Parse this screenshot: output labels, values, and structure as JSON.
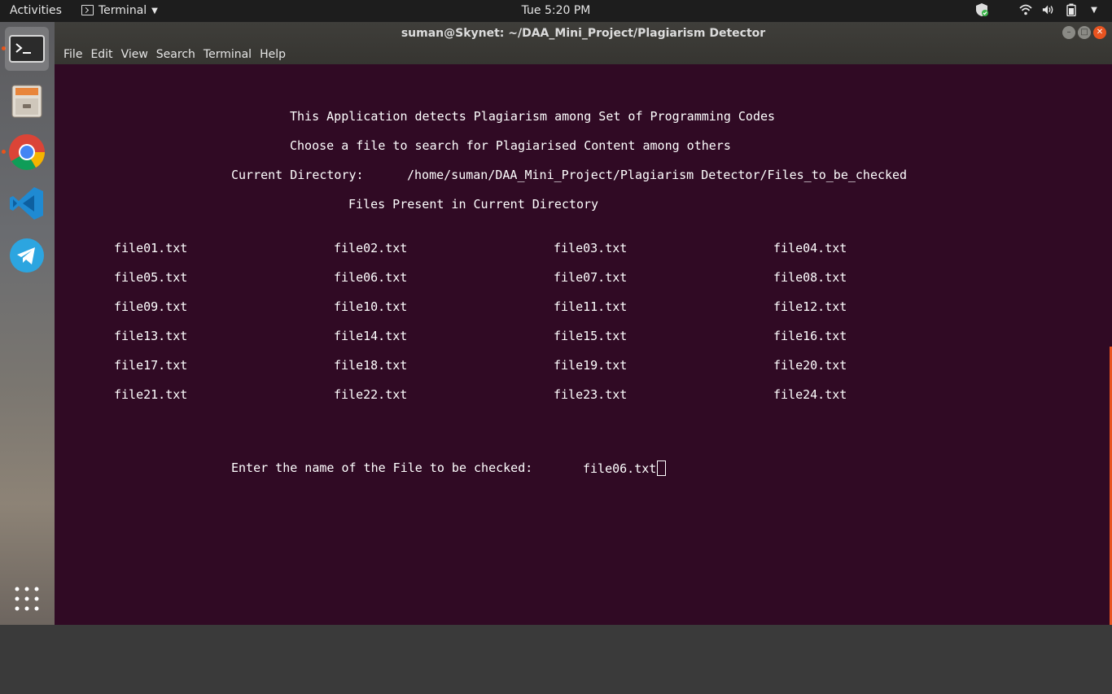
{
  "topbar": {
    "activities": "Activities",
    "app_name": "Terminal",
    "clock": "Tue  5:20 PM"
  },
  "dock": {
    "items": [
      "Terminal",
      "Files",
      "Google Chrome",
      "Visual Studio Code",
      "Telegram",
      "Show Applications"
    ]
  },
  "window": {
    "title": "suman@Skynet: ~/DAA_Mini_Project/Plagiarism Detector",
    "menu": [
      "File",
      "Edit",
      "View",
      "Search",
      "Terminal",
      "Help"
    ]
  },
  "terminal": {
    "line1": "This Application detects Plagiarism among Set of Programming Codes",
    "line2": "Choose a file to search for Plagiarised Content among others",
    "current_dir_label": "Current Directory:",
    "current_dir_value": "/home/suman/DAA_Mini_Project/Plagiarism Detector/Files_to_be_checked",
    "files_heading": "Files Present in Current Directory",
    "files": [
      [
        "file01.txt",
        "file02.txt",
        "file03.txt",
        "file04.txt"
      ],
      [
        "file05.txt",
        "file06.txt",
        "file07.txt",
        "file08.txt"
      ],
      [
        "file09.txt",
        "file10.txt",
        "file11.txt",
        "file12.txt"
      ],
      [
        "file13.txt",
        "file14.txt",
        "file15.txt",
        "file16.txt"
      ],
      [
        "file17.txt",
        "file18.txt",
        "file19.txt",
        "file20.txt"
      ],
      [
        "file21.txt",
        "file22.txt",
        "file23.txt",
        "file24.txt"
      ]
    ],
    "prompt_label": "Enter the name of the File to be checked:",
    "prompt_input": "file06.txt"
  },
  "colors": {
    "terminal_bg": "#300a24",
    "accent": "#e95420"
  }
}
